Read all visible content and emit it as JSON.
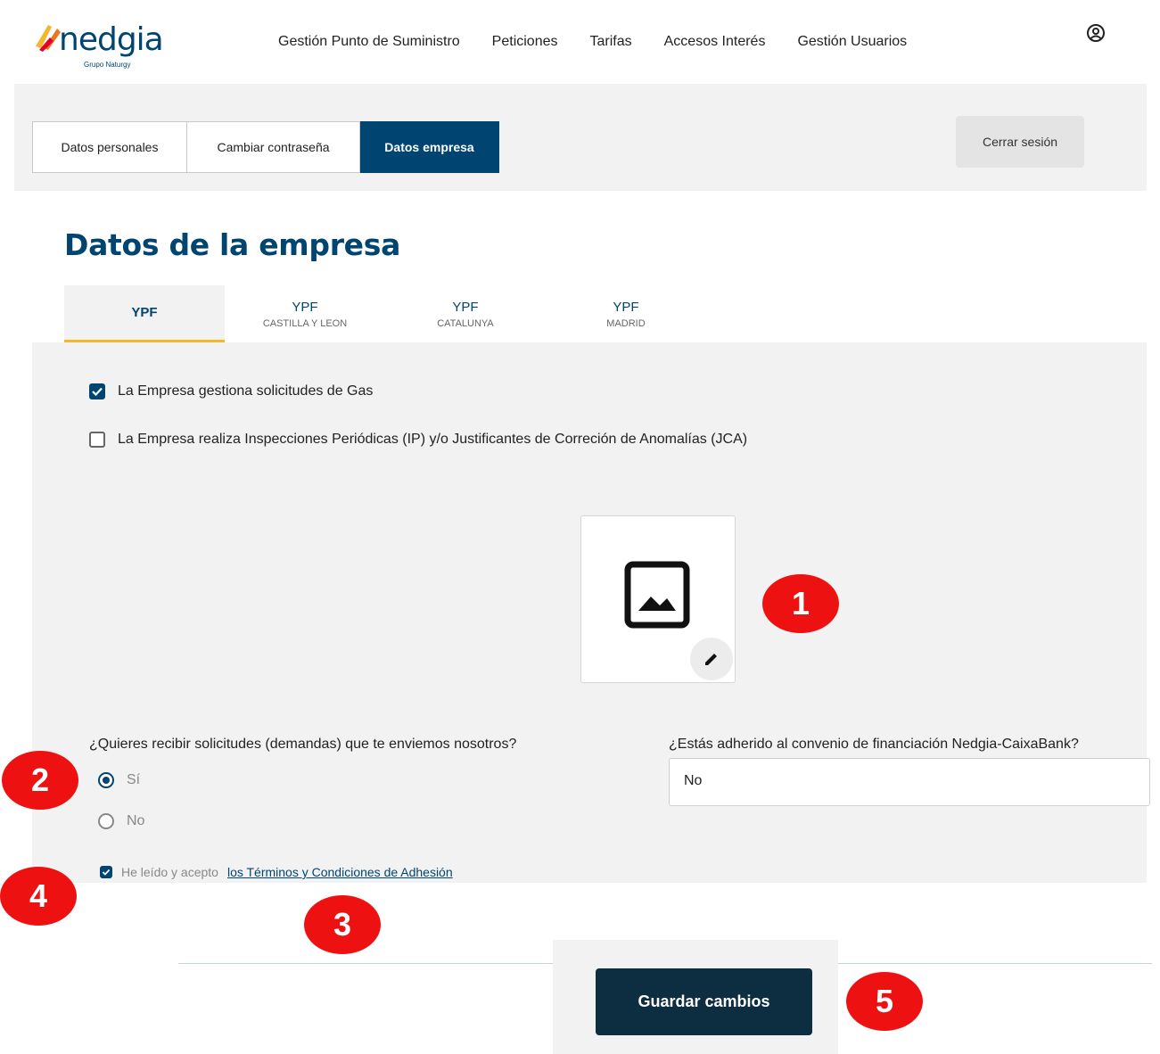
{
  "brand": {
    "name": "nedgia",
    "tagline": "Grupo Naturgy"
  },
  "nav": {
    "items": [
      "Gestión Punto de Suministro",
      "Peticiones",
      "Tarifas",
      "Accesos Interés",
      "Gestión Usuarios"
    ],
    "user_icon": "user-circle-icon"
  },
  "account_tabs": [
    "Datos personales",
    "Cambiar contraseña",
    "Datos empresa"
  ],
  "active_account_tab": "Datos empresa",
  "logout_label": "Cerrar sesión",
  "section_title": "Datos de la empresa",
  "company_tabs": [
    {
      "name": "YPF",
      "sub": ""
    },
    {
      "name": "YPF",
      "sub": "CASTILLA Y LEON"
    },
    {
      "name": "YPF",
      "sub": "CATALUNYA"
    },
    {
      "name": "YPF",
      "sub": "MADRID"
    }
  ],
  "options": {
    "gas_requests": {
      "label": "La Empresa gestiona solicitudes de Gas",
      "checked": true
    },
    "inspections": {
      "label": "La Empresa realiza Inspecciones Periódicas (IP) y/o Justificantes de Correción de Anomalías (JCA)",
      "checked": false
    }
  },
  "logo_upload": {
    "icon": "image-placeholder-icon",
    "edit_icon": "pencil-icon"
  },
  "demands_question": {
    "label": "¿Quieres recibir solicitudes (demandas) que te enviemos nosotros?",
    "options": [
      "Sí",
      "No"
    ],
    "selected": "Sí"
  },
  "financing_question": {
    "label": "¿Estás adherido al convenio de financiación Nedgia-CaixaBank?",
    "value": "No"
  },
  "terms": {
    "prefix": "He leído y acepto",
    "link_text": "los Términos y Condiciones de Adhesión",
    "checked": true
  },
  "save_label": "Guardar cambios",
  "markers": [
    "1",
    "2",
    "3",
    "4",
    "5"
  ],
  "colors": {
    "primary": "#004571",
    "dark_button": "#0d2d40",
    "accent": "#f2b82a",
    "marker": "#ee1111",
    "page_bg": "#f2f2f2"
  }
}
